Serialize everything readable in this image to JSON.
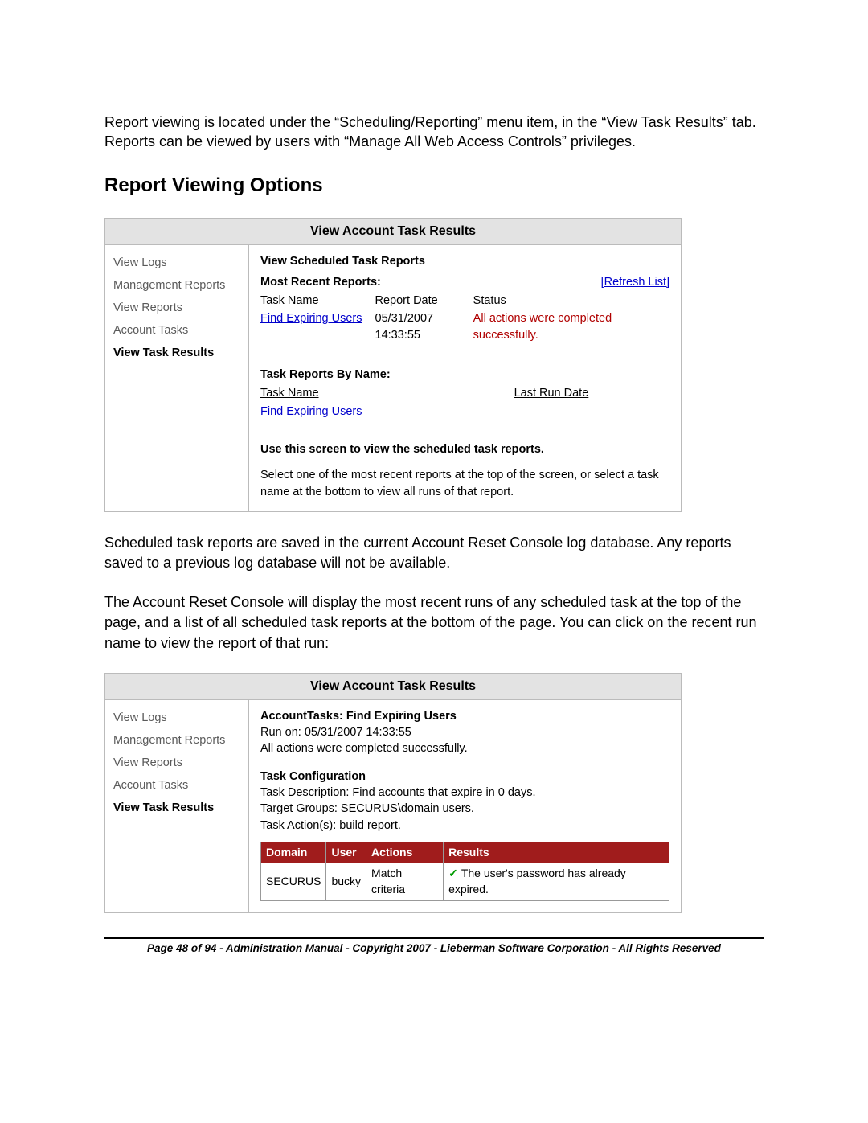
{
  "intro": "Report viewing is located under the “Scheduling/Reporting” menu item, in the “View Task Results” tab.  Reports can be viewed by users with “Manage All Web Access Controls” privileges.",
  "section_title": "Report Viewing Options",
  "panel1": {
    "header": "View Account Task Results",
    "sidebar": [
      "View Logs",
      "Management Reports",
      "View Reports",
      "Account Tasks",
      "View Task Results"
    ],
    "active_index": 4,
    "content": {
      "title": "View Scheduled Task Reports",
      "most_recent_label": "Most Recent Reports:",
      "refresh_label": "[Refresh List]",
      "col_task": "Task Name",
      "col_date": "Report Date",
      "col_status": "Status",
      "row1_task": "Find Expiring Users",
      "row1_date": "05/31/2007 14:33:55",
      "row1_status": "All actions were completed successfully.",
      "by_name_label": "Task Reports By Name:",
      "col2_task": "Task Name",
      "col2_last": "Last Run Date",
      "row2_task": "Find Expiring Users",
      "help_bold": "Use this screen to view the scheduled task reports.",
      "help_text": "Select one of the most recent reports at the top of the screen, or select a task name at the bottom to view all runs of that report."
    }
  },
  "mid1": "Scheduled task reports are saved in the current Account Reset Console log database.  Any reports saved to a previous log database will not be available.",
  "mid2": "The Account Reset Console will display the most recent runs of any scheduled task at the top of the page, and a list of all scheduled task reports at the bottom of the page.  You can click on the recent run name to view the report of that run:",
  "panel2": {
    "header": "View Account Task Results",
    "sidebar": [
      "View Logs",
      "Management Reports",
      "View Reports",
      "Account Tasks",
      "View Task Results"
    ],
    "active_index": 4,
    "content": {
      "line1": "AccountTasks: Find Expiring Users",
      "line2": "Run on: 05/31/2007 14:33:55",
      "line3": "All actions were completed successfully.",
      "tc_label": "Task Configuration",
      "tc1": "Task Description: Find accounts that expire in 0 days.",
      "tc2": "Target Groups: SECURUS\\domain users.",
      "tc3": "Task Action(s): build report.",
      "headers": [
        "Domain",
        "User",
        "Actions",
        "Results"
      ],
      "row": {
        "domain": "SECURUS",
        "user": "bucky",
        "actions": "Match criteria",
        "results": "The user's password has already expired."
      }
    }
  },
  "footer": "Page 48 of 94 - Administration Manual - Copyright 2007 - Lieberman Software Corporation - All Rights Reserved"
}
